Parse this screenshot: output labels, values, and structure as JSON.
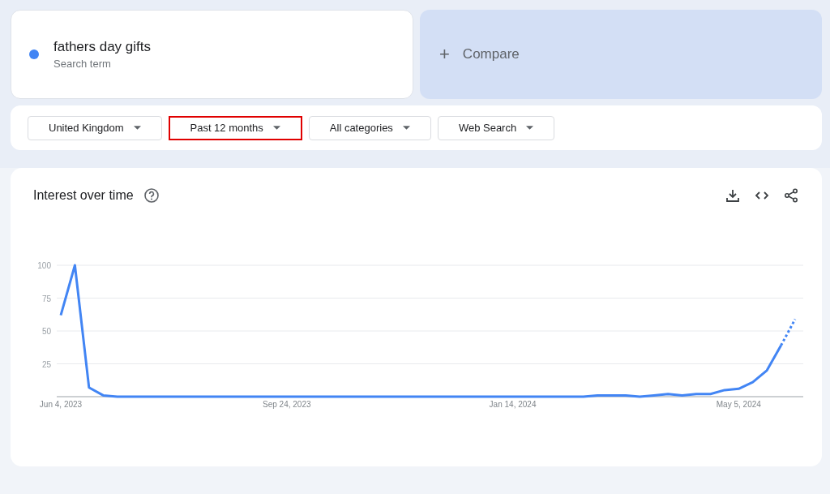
{
  "search_term": {
    "term": "fathers day gifts",
    "subtitle": "Search term",
    "color": "#4285f4"
  },
  "compare": {
    "icon": "+",
    "label": "Compare"
  },
  "filters": [
    {
      "label": "United Kingdom",
      "selected": false
    },
    {
      "label": "Past 12 months",
      "selected": true
    },
    {
      "label": "All categories",
      "selected": false
    },
    {
      "label": "Web Search",
      "selected": false
    }
  ],
  "chart_card": {
    "title": "Interest over time",
    "chart_data": {
      "type": "line",
      "categories": [
        "Jun 4, 2023",
        null,
        null,
        null,
        null,
        null,
        null,
        null,
        null,
        null,
        null,
        null,
        null,
        null,
        null,
        null,
        "Sep 24, 2023",
        null,
        null,
        null,
        null,
        null,
        null,
        null,
        null,
        null,
        null,
        null,
        null,
        null,
        null,
        null,
        "Jan 14, 2024",
        null,
        null,
        null,
        null,
        null,
        null,
        null,
        null,
        null,
        null,
        null,
        null,
        null,
        null,
        null,
        "May 5, 2024",
        null,
        null,
        null,
        null
      ],
      "series": [
        {
          "color": "#4285f4",
          "values": [
            62,
            100,
            7,
            1,
            0,
            0,
            0,
            0,
            0,
            0,
            0,
            0,
            0,
            0,
            0,
            0,
            0,
            0,
            0,
            0,
            0,
            0,
            0,
            0,
            0,
            0,
            0,
            0,
            0,
            0,
            0,
            0,
            0,
            0,
            0,
            0,
            0,
            0,
            1,
            1,
            1,
            0,
            1,
            2,
            1,
            2,
            2,
            5,
            6,
            11,
            20,
            39,
            59
          ]
        }
      ],
      "grid": true,
      "ylim": [
        0,
        100
      ],
      "yticks": [
        25,
        50,
        75,
        100
      ]
    }
  }
}
